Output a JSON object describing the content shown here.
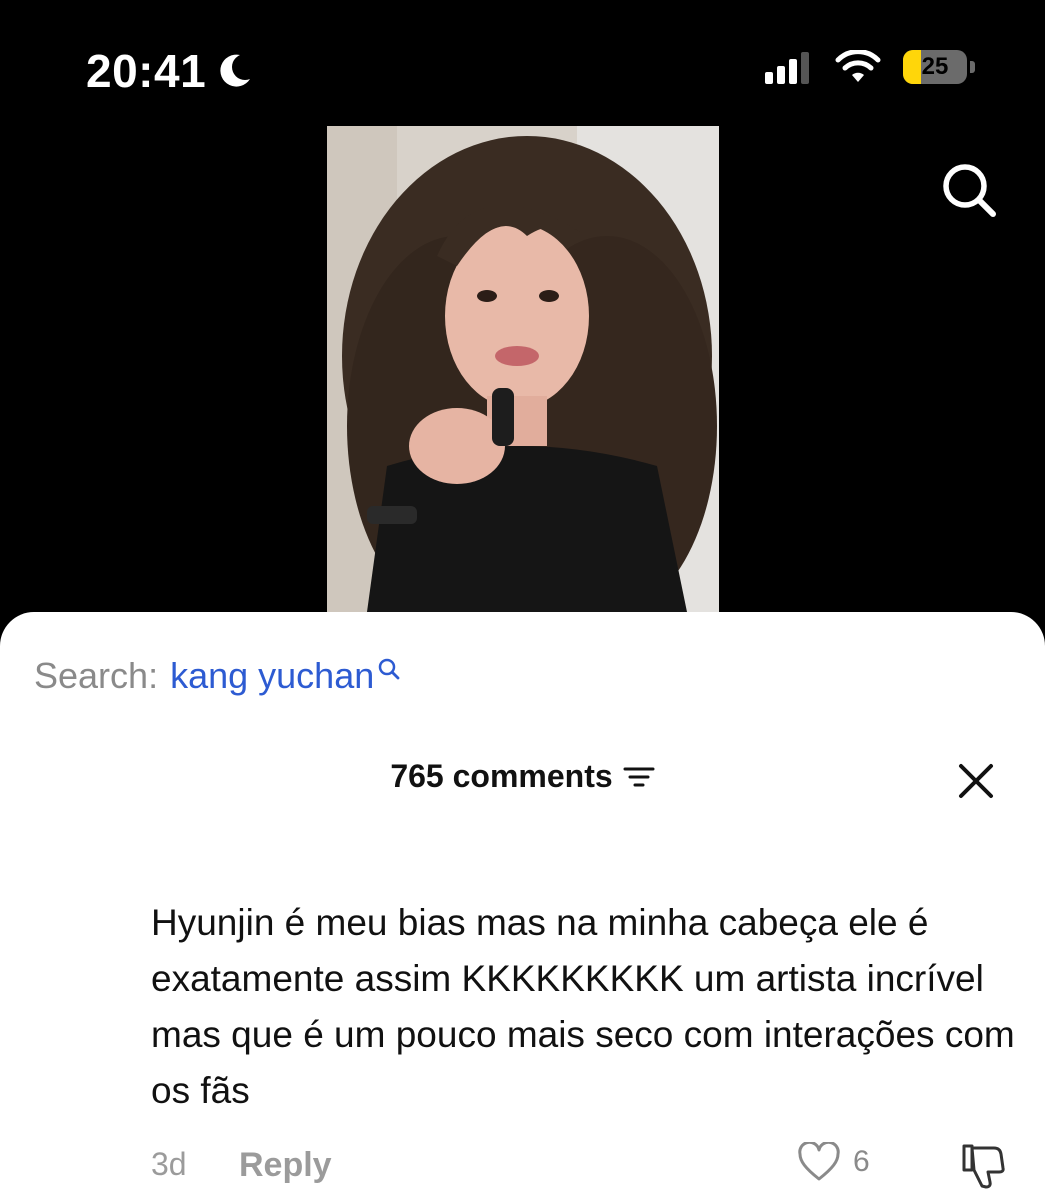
{
  "status_bar": {
    "time": "20:41",
    "battery_level": "25",
    "icons": [
      "moon-icon",
      "cellular-signal-icon",
      "wifi-icon",
      "battery-icon"
    ]
  },
  "video": {
    "description_icon": "video-thumbnail"
  },
  "search_suggestion": {
    "label": "Search:",
    "query": "kang yuchan"
  },
  "comments": {
    "count_label": "765 comments",
    "items": [
      {
        "text": "Hyunjin é meu bias mas na minha cabeça ele é exatamente assim KKKKKKKKK um artista incrível mas que é um pouco mais seco com interações com os fãs",
        "age": "3d",
        "reply_label": "Reply",
        "likes": "6"
      }
    ]
  },
  "colors": {
    "accent_link": "#2d5bd2",
    "battery_low": "#ffd60a"
  }
}
